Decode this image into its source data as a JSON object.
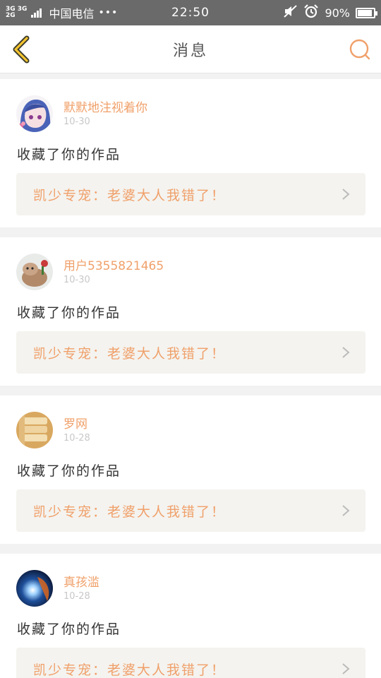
{
  "status_bar": {
    "network_top": "3G 3G",
    "network_bottom": "2G",
    "carrier": "中国电信",
    "dots": "•••",
    "time": "22:50",
    "battery_text": "90%",
    "battery_level": 0.9
  },
  "header": {
    "title": "消息",
    "back_icon": "chevron-left-icon",
    "search_icon": "search-icon",
    "accent_color": "#f0a06a"
  },
  "messages": [
    {
      "username": "默默地注视着你",
      "date": "10-30",
      "action": "收藏了你的作品",
      "work_title": "凯少专宠：老婆大人我错了！"
    },
    {
      "username": "用户5355821465",
      "date": "10-30",
      "action": "收藏了你的作品",
      "work_title": "凯少专宠：老婆大人我错了！"
    },
    {
      "username": "罗网",
      "date": "10-28",
      "action": "收藏了你的作品",
      "work_title": "凯少专宠：老婆大人我错了！"
    },
    {
      "username": "真孩滥",
      "date": "10-28",
      "action": "收藏了你的作品",
      "work_title": "凯少专宠：老婆大人我错了！"
    }
  ]
}
